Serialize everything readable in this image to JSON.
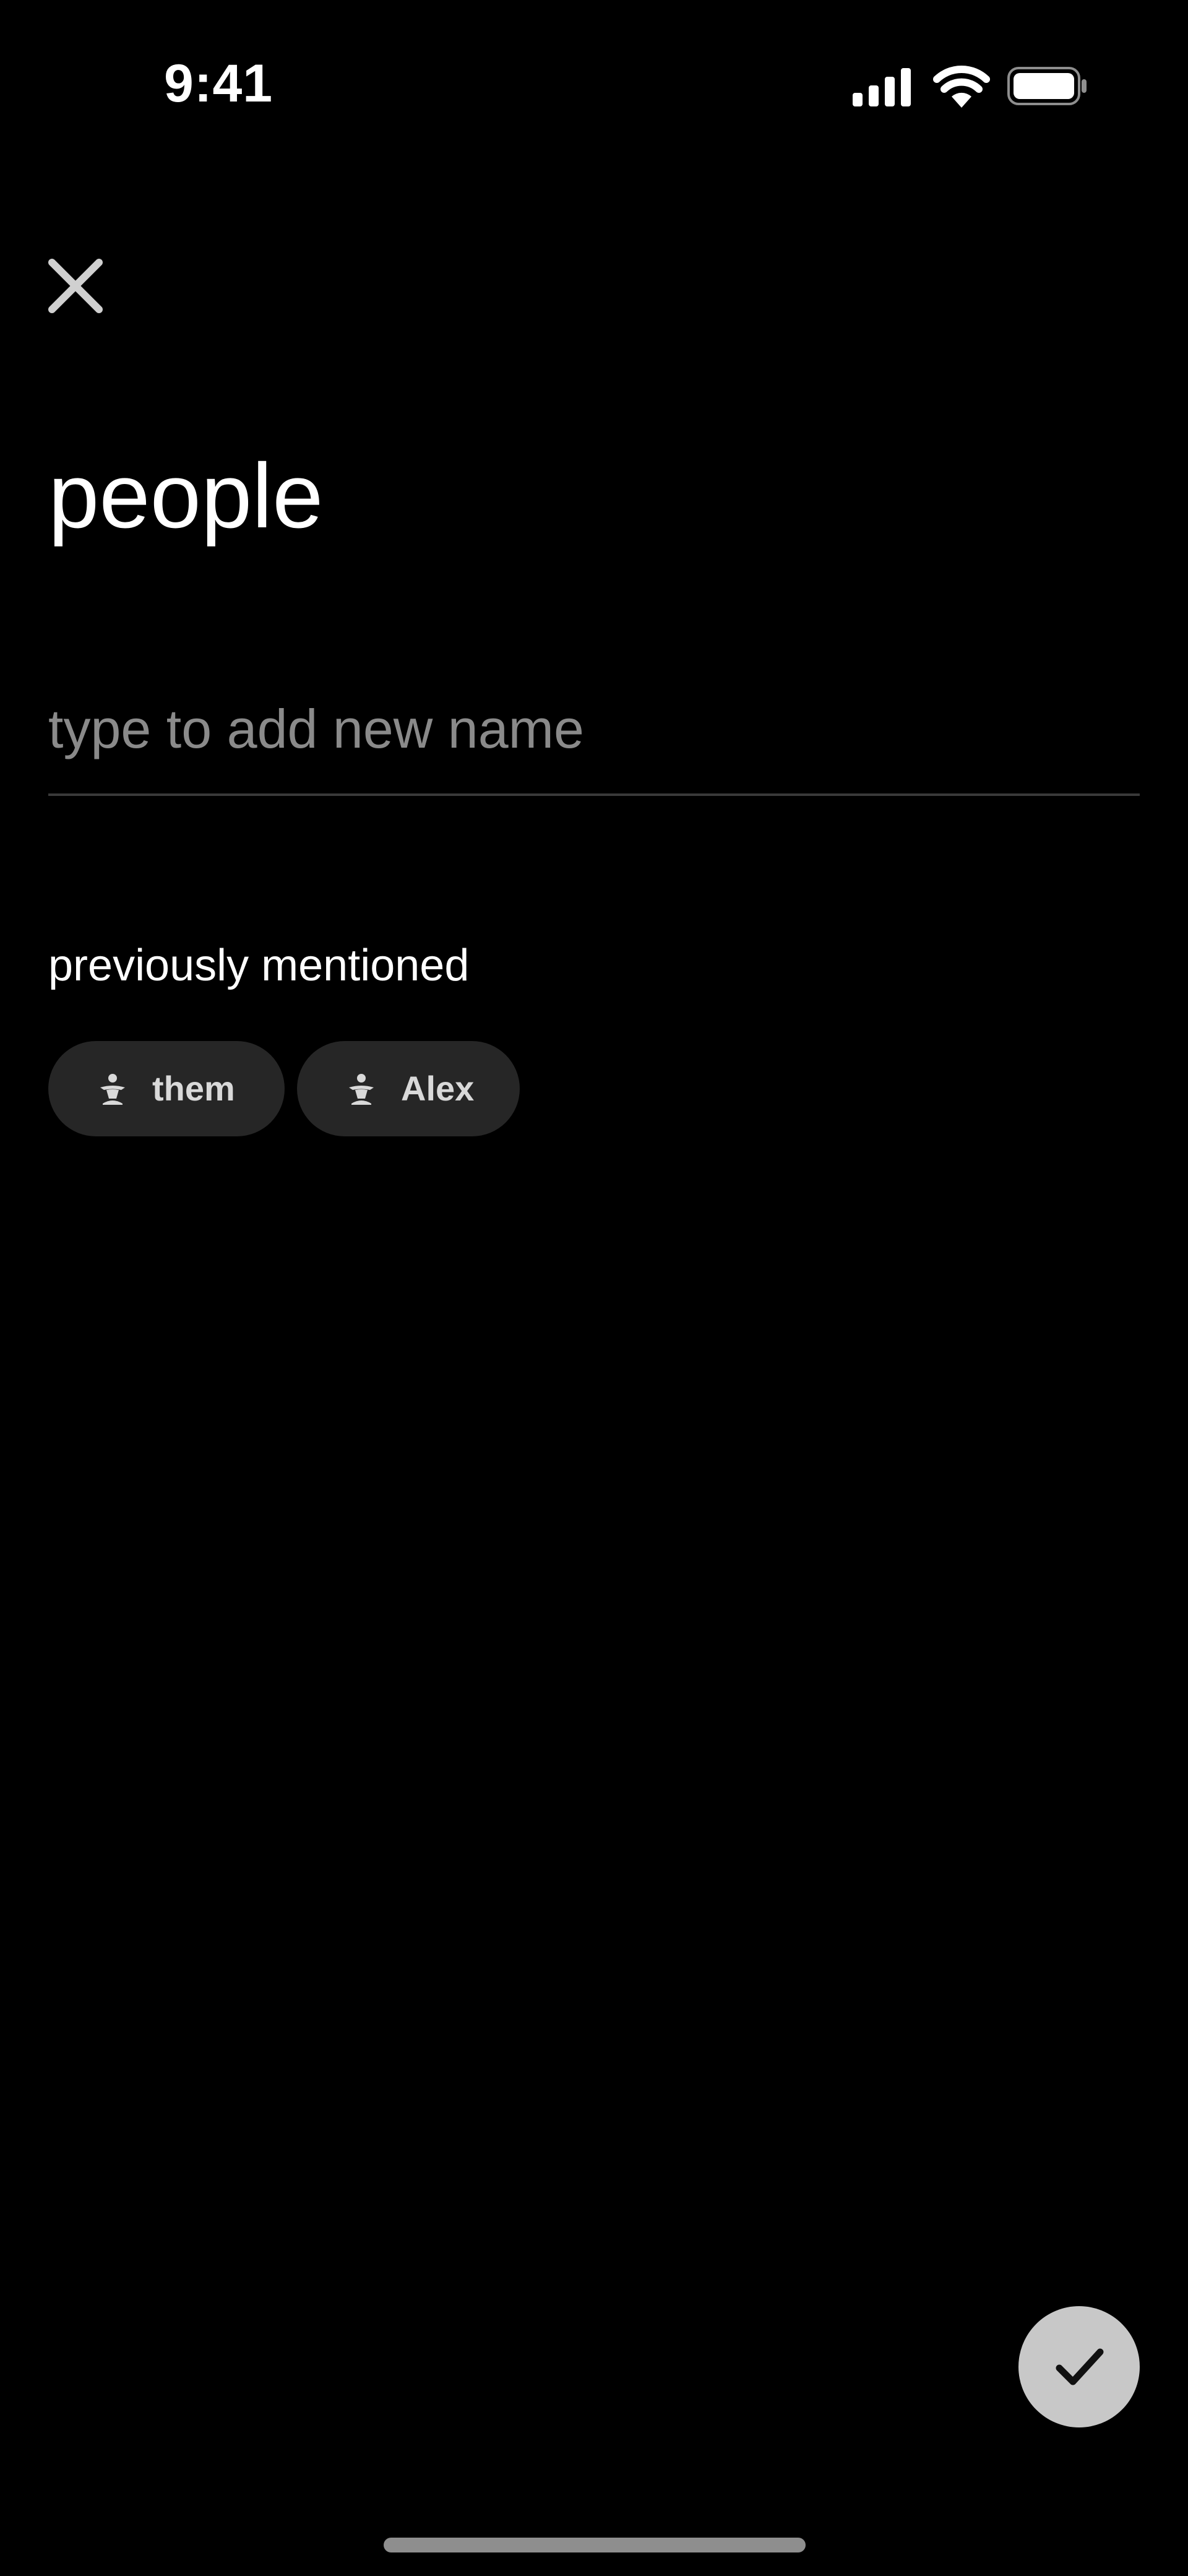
{
  "status_bar": {
    "time": "9:41",
    "signal_icon": "cellular-signal-icon",
    "wifi_icon": "wifi-icon",
    "battery_icon": "battery-icon"
  },
  "header": {
    "close_icon": "close-icon"
  },
  "page": {
    "title": "people"
  },
  "name_input": {
    "value": "",
    "placeholder": "type to add new name"
  },
  "previously_mentioned": {
    "label": "previously mentioned",
    "chips": [
      {
        "label": "them",
        "icon": "person-icon"
      },
      {
        "label": "Alex",
        "icon": "person-icon"
      }
    ]
  },
  "confirm": {
    "icon": "checkmark-icon"
  },
  "colors": {
    "background": "#000000",
    "chip_background": "#262626",
    "chip_text": "#d9d9d9",
    "placeholder": "#8a8a8a",
    "confirm_button": "#c8c8c8"
  }
}
